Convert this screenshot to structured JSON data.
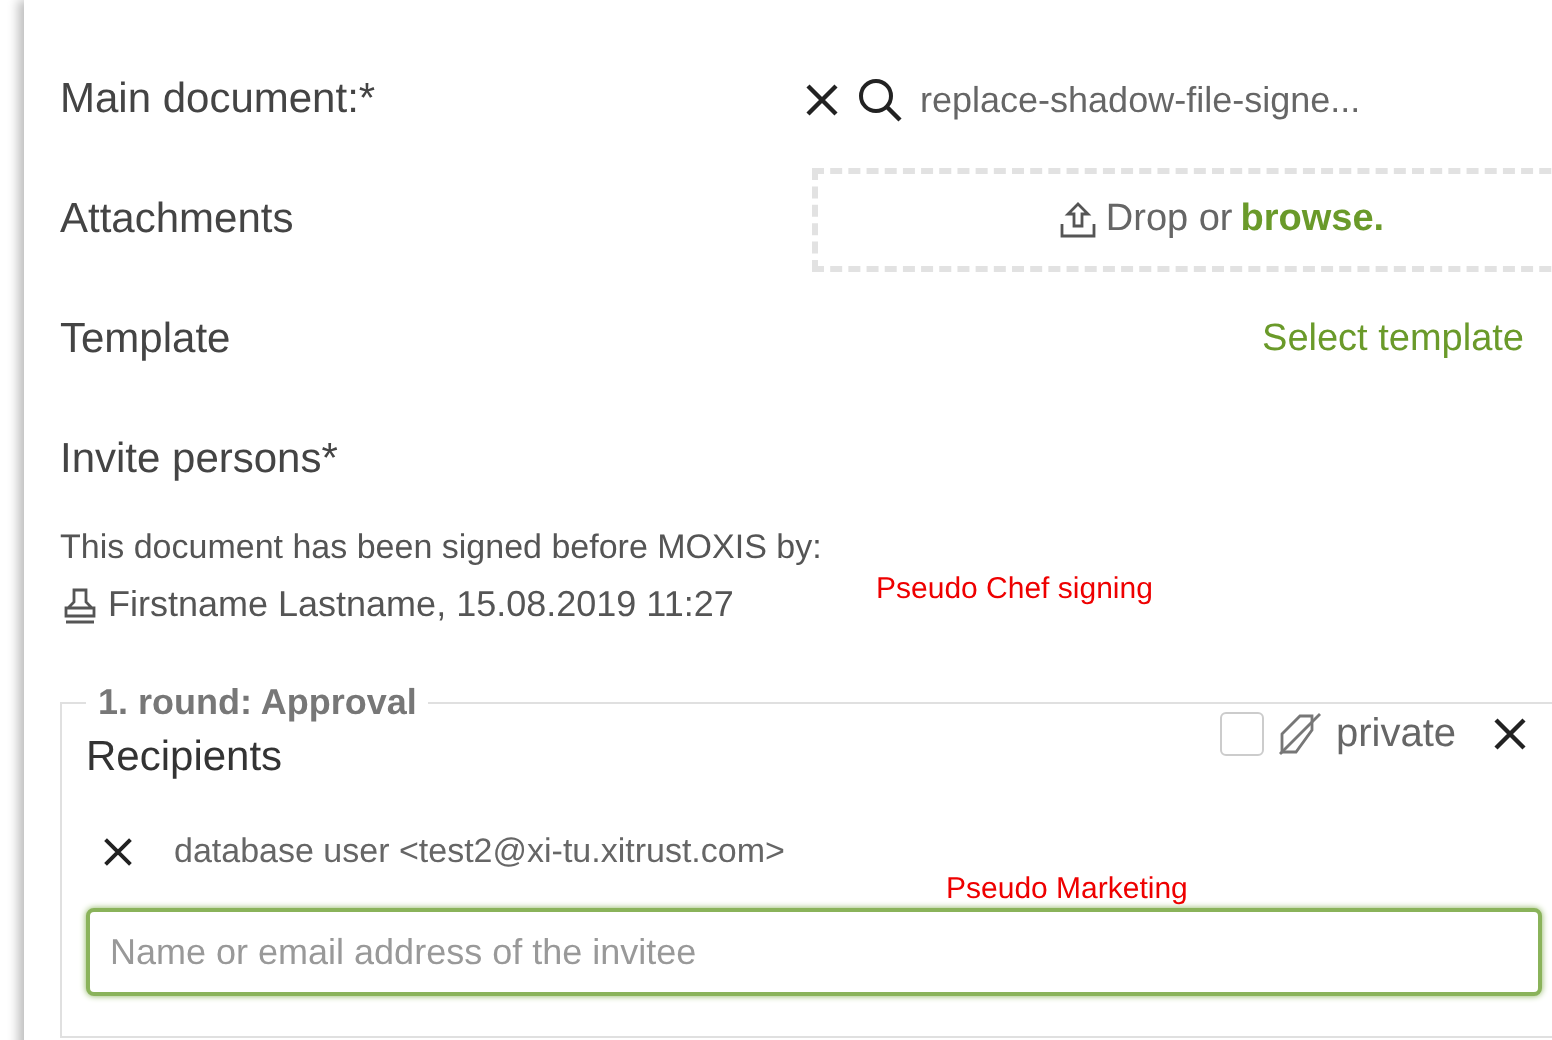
{
  "main_document": {
    "label": "Main document:*",
    "file": "replace-shadow-file-signe..."
  },
  "attachments": {
    "label": "Attachments",
    "drop_text": "Drop or",
    "browse": "browse."
  },
  "template": {
    "label": "Template",
    "link": "Select template"
  },
  "invite": {
    "label": "Invite persons*",
    "signed_note": "This document has been signed before MOXIS by:",
    "signer": "Firstname Lastname, 15.08.2019 11:27",
    "annotation": "Pseudo Chef signing"
  },
  "round": {
    "legend": "1. round: Approval",
    "recipients_label": "Recipients",
    "private": {
      "label": "private",
      "checked": false
    },
    "recipients": [
      {
        "name": "database user <test2@xi-tu.xitrust.com>",
        "annotation": "Pseudo Marketing"
      }
    ],
    "input": {
      "placeholder": "Name or email address of the invitee"
    }
  }
}
